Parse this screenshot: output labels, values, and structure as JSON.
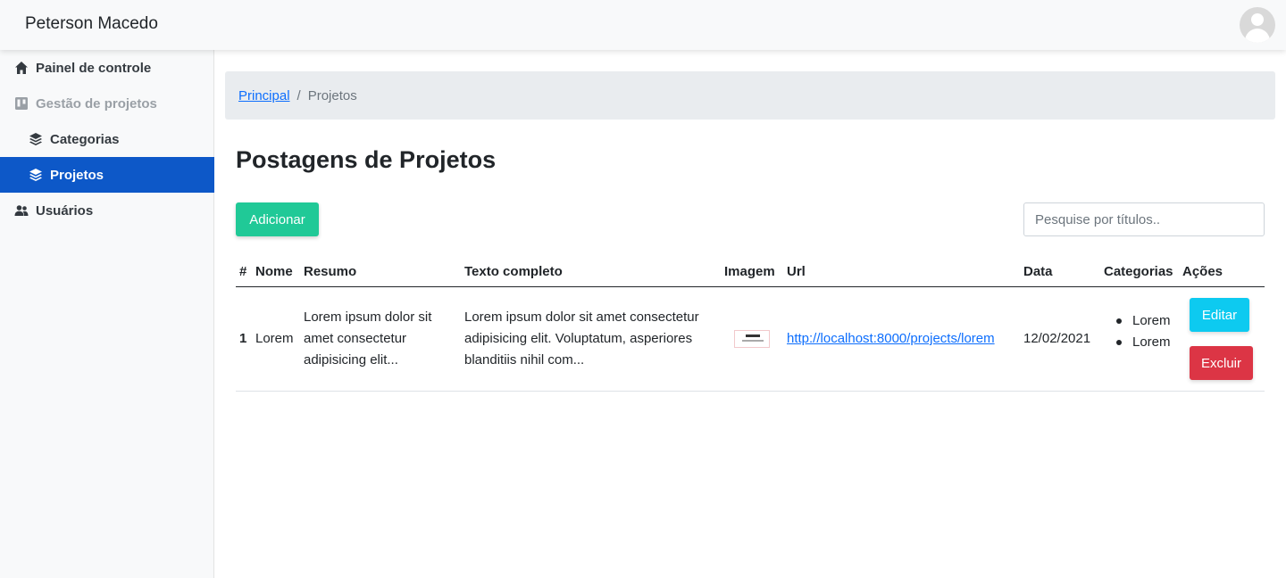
{
  "topbar": {
    "brand": "Peterson Macedo",
    "avatar_icon": "user-avatar-icon"
  },
  "sidebar": {
    "items": [
      {
        "label": "Painel de controle",
        "icon": "home-icon"
      },
      {
        "label": "Gestão de projetos",
        "icon": "kanban-icon"
      },
      {
        "label": "Categorias",
        "icon": "layers-icon"
      },
      {
        "label": "Projetos",
        "icon": "layers-icon"
      },
      {
        "label": "Usuários",
        "icon": "users-icon"
      }
    ],
    "active_color": "#0d58c8"
  },
  "breadcrumb": {
    "home": "Principal",
    "separator": "/",
    "current": "Projetos"
  },
  "page": {
    "title": "Postagens de Projetos"
  },
  "toolbar": {
    "add_label": "Adicionar",
    "search_placeholder": "Pesquise por títulos.."
  },
  "table": {
    "headers": [
      "#",
      "Nome",
      "Resumo",
      "Texto completo",
      "Imagem",
      "Url",
      "Data",
      "Categorias",
      "Ações"
    ],
    "rows": [
      {
        "id": "1",
        "name": "Lorem",
        "summary": "Lorem ipsum dolor sit amet consectetur adipisicing elit...",
        "full_text": "Lorem ipsum dolor sit amet consectetur adipisicing elit. Voluptatum, asperiores blanditiis nihil com...",
        "url": "http://localhost:8000/projects/lorem",
        "date": "12/02/2021",
        "categories": [
          "Lorem",
          "Lorem"
        ],
        "edit_label": "Editar",
        "delete_label": "Excluir"
      }
    ]
  },
  "colors": {
    "add": "#20c997",
    "edit": "#0dcaf0",
    "delete": "#dc3545",
    "link": "#0d6efd"
  }
}
